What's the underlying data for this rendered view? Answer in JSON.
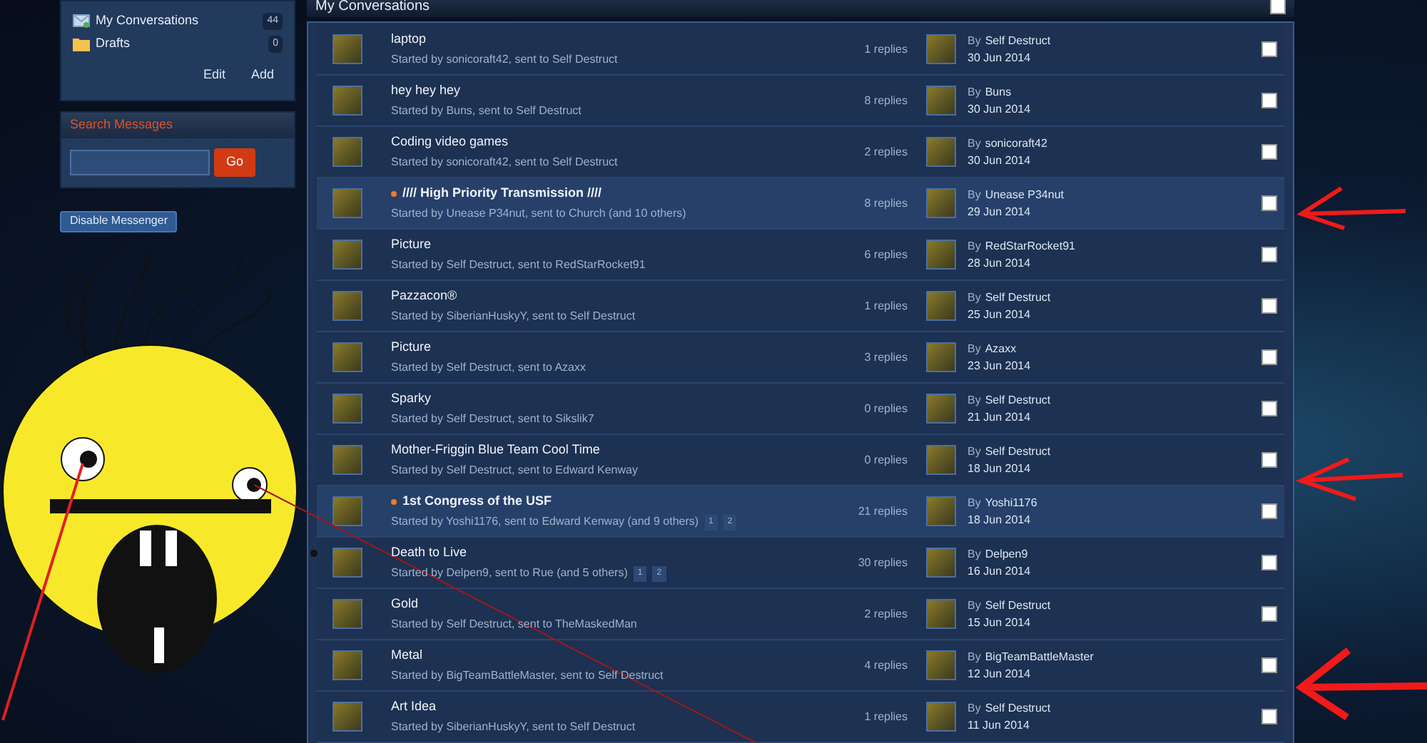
{
  "sidebar": {
    "folders": [
      {
        "label": "My Conversations",
        "count": "44",
        "kind": "inbox"
      },
      {
        "label": "Drafts",
        "count": "0",
        "kind": "folder"
      }
    ],
    "actions": [
      "Edit",
      "Add"
    ],
    "search": {
      "title": "Search Messages",
      "button": "Go"
    },
    "disable_button": "Disable Messenger"
  },
  "main": {
    "title": "My Conversations",
    "select_all": {
      "checked": false
    },
    "conversations": [
      {
        "title": "laptop",
        "started": "Started by sonicoraft42, sent to Self Destruct",
        "replies": "1 replies",
        "by_label": "By",
        "last_poster": "Self Destruct",
        "date": "30 Jun 2014",
        "unread": false,
        "checked": false
      },
      {
        "title": "hey hey hey",
        "started": "Started by Buns, sent to Self Destruct",
        "replies": "8 replies",
        "by_label": "By",
        "last_poster": "Buns",
        "date": "30 Jun 2014",
        "unread": false,
        "checked": false
      },
      {
        "title": "Coding video games",
        "started": "Started by sonicoraft42, sent to Self Destruct",
        "replies": "2 replies",
        "by_label": "By",
        "last_poster": "sonicoraft42",
        "date": "30 Jun 2014",
        "unread": false,
        "checked": false
      },
      {
        "title": "//// High Priority Transmission ////",
        "started": "Started by Unease P34nut, sent to Church (and 10 others)",
        "replies": "8 replies",
        "by_label": "By",
        "last_poster": "Unease P34nut",
        "date": "29 Jun 2014",
        "unread": true,
        "checked": false
      },
      {
        "title": "Picture",
        "started": "Started by Self Destruct, sent to RedStarRocket91",
        "replies": "6 replies",
        "by_label": "By",
        "last_poster": "RedStarRocket91",
        "date": "28 Jun 2014",
        "unread": false,
        "checked": false
      },
      {
        "title": "Pazzacon®",
        "started": "Started by SiberianHuskyY, sent to Self Destruct",
        "replies": "1 replies",
        "by_label": "By",
        "last_poster": "Self Destruct",
        "date": "25 Jun 2014",
        "unread": false,
        "checked": false
      },
      {
        "title": "Picture",
        "started": "Started by Self Destruct, sent to Azaxx",
        "replies": "3 replies",
        "by_label": "By",
        "last_poster": "Azaxx",
        "date": "23 Jun 2014",
        "unread": false,
        "checked": false
      },
      {
        "title": "Sparky",
        "started": "Started by Self Destruct, sent to Sikslik7",
        "replies": "0 replies",
        "by_label": "By",
        "last_poster": "Self Destruct",
        "date": "21 Jun 2014",
        "unread": false,
        "checked": false
      },
      {
        "title": "Mother-Friggin Blue Team Cool Time",
        "started": "Started by Self Destruct, sent to Edward Kenway",
        "replies": "0 replies",
        "by_label": "By",
        "last_poster": "Self Destruct",
        "date": "18 Jun 2014",
        "unread": false,
        "checked": false
      },
      {
        "title": "1st Congress of the USF",
        "started": "Started by Yoshi1176, sent to Edward Kenway (and 9 others)",
        "pages": [
          "1",
          "2"
        ],
        "replies": "21 replies",
        "by_label": "By",
        "last_poster": "Yoshi1176",
        "date": "18 Jun 2014",
        "unread": true,
        "checked": false
      },
      {
        "title": "Death to Live",
        "started": "Started by Delpen9, sent to Rue (and 5 others)",
        "pages": [
          "1",
          "2"
        ],
        "replies": "30 replies",
        "by_label": "By",
        "last_poster": "Delpen9",
        "date": "16 Jun 2014",
        "unread": false,
        "checked": false
      },
      {
        "title": "Gold",
        "started": "Started by Self Destruct, sent to TheMaskedMan",
        "replies": "2 replies",
        "by_label": "By",
        "last_poster": "Self Destruct",
        "date": "15 Jun 2014",
        "unread": false,
        "checked": false
      },
      {
        "title": "Metal",
        "started": "Started by BigTeamBattleMaster, sent to Self Destruct",
        "replies": "4 replies",
        "by_label": "By",
        "last_poster": "BigTeamBattleMaster",
        "date": "12 Jun 2014",
        "unread": false,
        "checked": false
      },
      {
        "title": "Art Idea",
        "started": "Started by SiberianHuskyY, sent to Self Destruct",
        "replies": "1 replies",
        "by_label": "By",
        "last_poster": "Self Destruct",
        "date": "11 Jun 2014",
        "unread": false,
        "checked": false
      }
    ]
  }
}
